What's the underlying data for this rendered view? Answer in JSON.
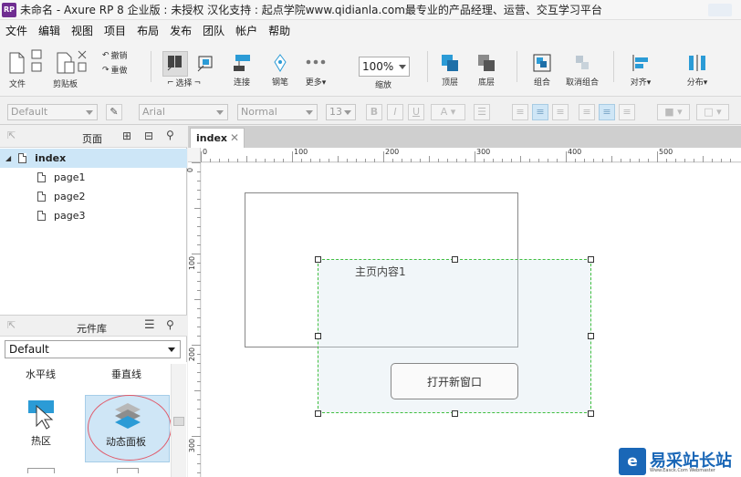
{
  "window": {
    "title": "未命名 - Axure RP 8 企业版 : 未授权 汉化支持 : 起点学院www.qidianla.com最专业的产品经理、运营、交互学习平台",
    "icon_text": "RP"
  },
  "menu": {
    "items": [
      "文件",
      "编辑",
      "视图",
      "项目",
      "布局",
      "发布",
      "团队",
      "帐户",
      "帮助"
    ]
  },
  "toolbar": {
    "file": "文件",
    "clipboard": "剪贴板",
    "undo": "撤销",
    "redo": "重做",
    "select": "选择",
    "connect": "连接",
    "pen": "钢笔",
    "more": "更多▾",
    "zoom_value": "100%",
    "zoom_label": "缩放",
    "top": "顶层",
    "bottom": "底层",
    "group": "组合",
    "ungroup": "取消组合",
    "align": "对齐▾",
    "distribute": "分布▾"
  },
  "format": {
    "style": "Default",
    "font": "Arial",
    "weight": "Normal",
    "size": "13"
  },
  "pages_panel": {
    "title": "页面",
    "root": "index",
    "children": [
      "page1",
      "page2",
      "page3"
    ]
  },
  "library_panel": {
    "title": "元件库",
    "selected_library": "Default",
    "widgets": {
      "hline": "水平线",
      "vline": "垂直线",
      "hotspot": "热区",
      "dynamic_panel": "动态面板"
    }
  },
  "canvas": {
    "tab": "index",
    "tab_close": "✕",
    "ruler_h": [
      "0",
      "100",
      "200",
      "300",
      "400",
      "500"
    ],
    "ruler_v": [
      "0",
      "100",
      "200",
      "300"
    ],
    "dynamic_text": "主页内容1",
    "open_button": "打开新窗口"
  },
  "watermark": {
    "logo": "e",
    "text": "易采站长站",
    "sub": "Www.Easck.Com  Webmaster"
  }
}
